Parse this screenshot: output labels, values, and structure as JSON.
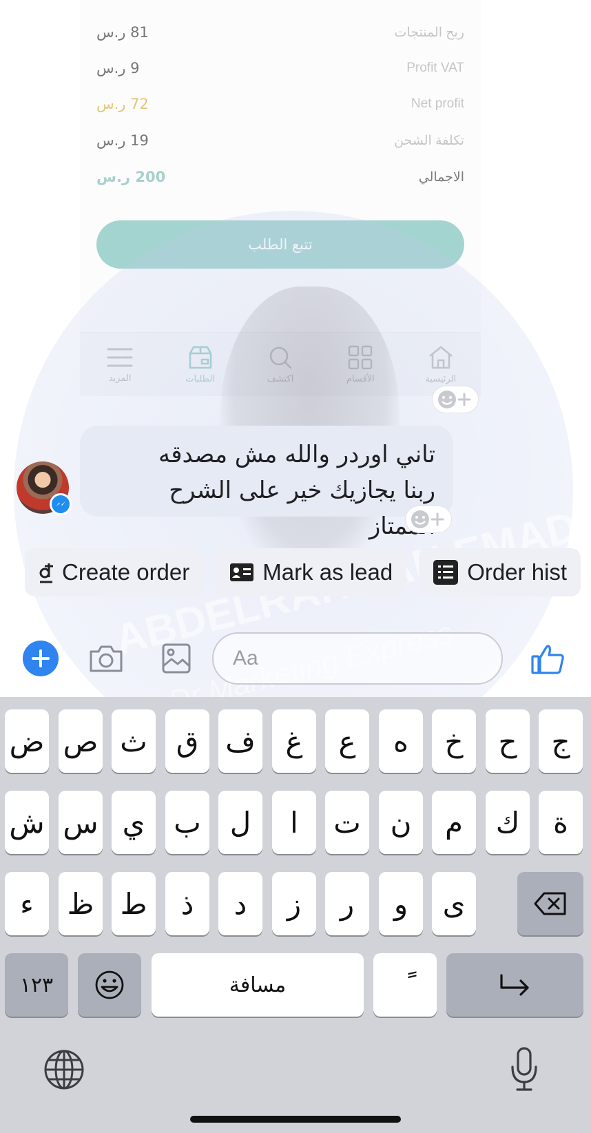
{
  "order_summary": {
    "rows": [
      {
        "label": "ربح المنتجات",
        "value": "81 ر.س"
      },
      {
        "label": "Profit VAT",
        "value": "9 ر.س"
      },
      {
        "label": "Net profit",
        "value": "72 ر.س"
      },
      {
        "label": "تكلفة الشحن",
        "value": "19 ر.س"
      },
      {
        "label": "الاجمالي",
        "value": "200 ر.س"
      }
    ],
    "track_button": "تتبع الطلب",
    "colors": {
      "net_profit": "#d4a62c",
      "total": "#78b9b2",
      "button": "#74bdb5"
    }
  },
  "app_nav": {
    "items": [
      {
        "label": "المزيد",
        "icon": "menu-icon"
      },
      {
        "label": "الطلبات",
        "icon": "orders-box-icon",
        "active": true
      },
      {
        "label": "اكتشف",
        "icon": "search-icon"
      },
      {
        "label": "الأقسام",
        "icon": "grid-icon"
      },
      {
        "label": "الرئيسية",
        "icon": "home-icon"
      }
    ]
  },
  "watermark": {
    "name": "ABDELRAHMAN EMAD",
    "tagline": "Dr Marketing Express"
  },
  "chat": {
    "message_line1": "تاني اوردر والله مش مصدقه",
    "message_line2": "ربنا يجازيك خير على الشرح الممتاز"
  },
  "quick_replies": [
    {
      "label": "Create order",
      "icon": "dong-currency-icon"
    },
    {
      "label": "Mark as lead",
      "icon": "contact-card-icon"
    },
    {
      "label": "Order hist",
      "icon": "order-list-icon"
    }
  ],
  "composer": {
    "placeholder": "Aa",
    "accent": "#2f84ef"
  },
  "keyboard": {
    "row1": [
      "ض",
      "ص",
      "ث",
      "ق",
      "ف",
      "غ",
      "ع",
      "ه",
      "خ",
      "ح",
      "ج"
    ],
    "row2": [
      "ش",
      "س",
      "ي",
      "ب",
      "ل",
      "ا",
      "ت",
      "ن",
      "م",
      "ك",
      "ة"
    ],
    "row3": [
      "ء",
      "ظ",
      "ط",
      "ذ",
      "د",
      "ز",
      "ر",
      "و",
      "ى"
    ],
    "numbers_key": "١٢٣",
    "space_key": "مسافة",
    "diacritic_key": "ً"
  }
}
